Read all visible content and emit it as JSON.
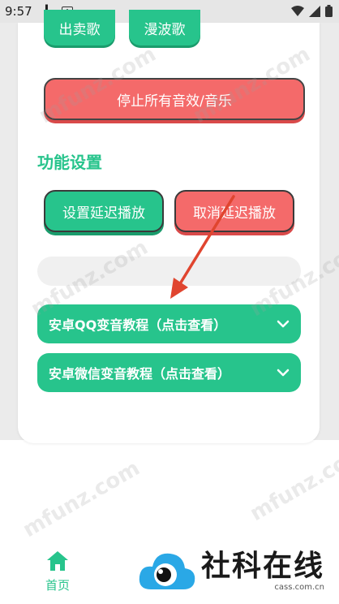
{
  "status_bar": {
    "time": "9:57"
  },
  "buttons": {
    "sell_song": "出卖歌",
    "wave_song": "漫波歌",
    "stop_all": "停止所有音效/音乐"
  },
  "section": {
    "title": "功能设置"
  },
  "delay": {
    "set_label": "设置延迟播放",
    "cancel_label": "取消延迟播放"
  },
  "tutorials": [
    {
      "label": "安卓QQ变音教程（点击查看）"
    },
    {
      "label": "安卓微信变音教程（点击查看）"
    }
  ],
  "nav": {
    "home_label": "首页"
  },
  "brand": {
    "name": "社科在线",
    "url": "cass.com.cn"
  },
  "watermark": "mfunz.com",
  "colors": {
    "accent": "#27c48c",
    "danger": "#f46a6a",
    "annotation_arrow": "#e0452f"
  }
}
